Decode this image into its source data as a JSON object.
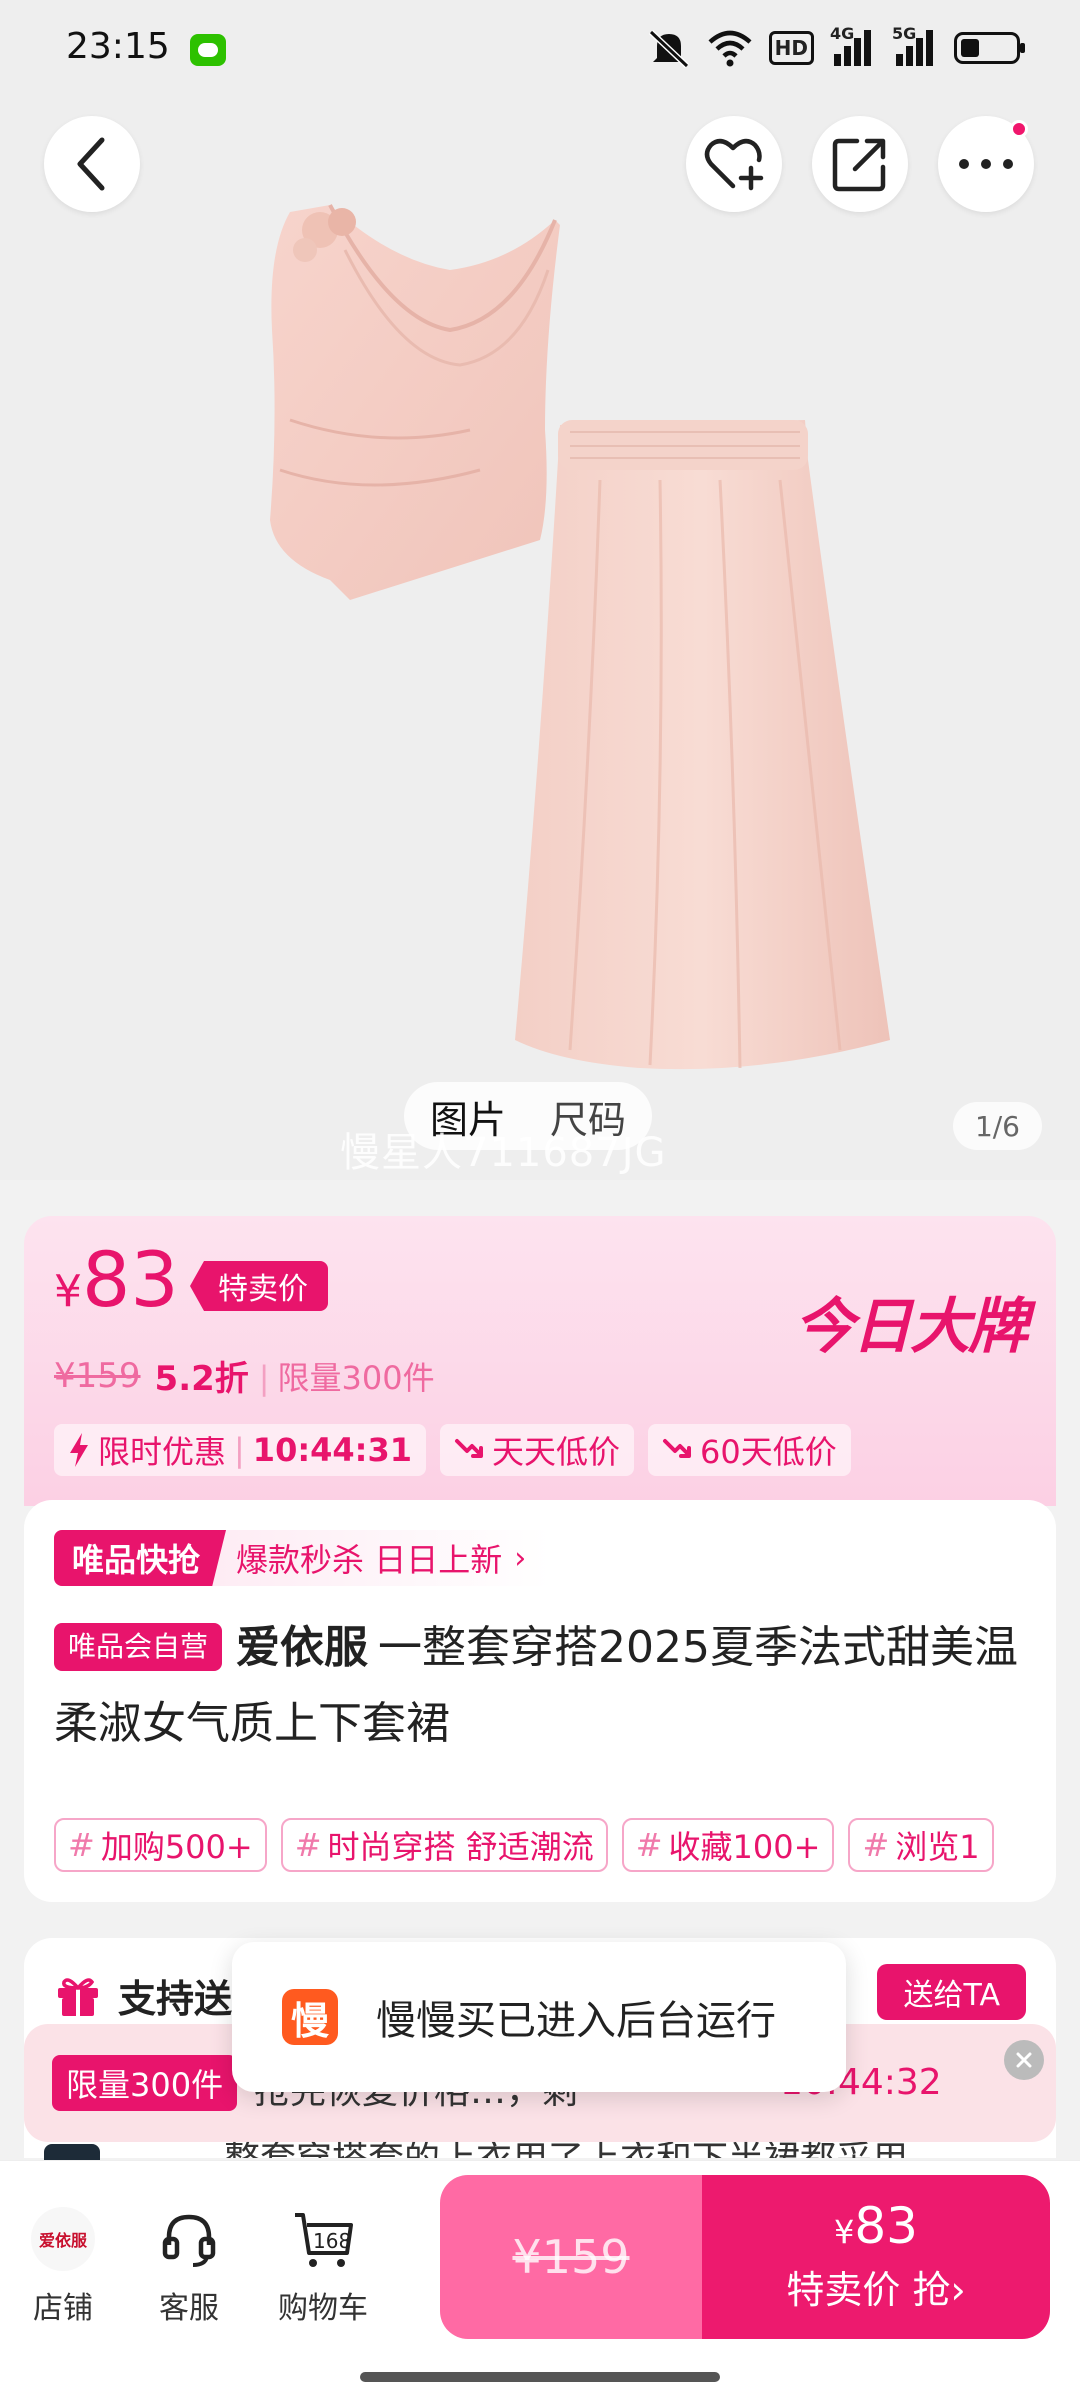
{
  "status_bar": {
    "time": "23:15",
    "hd_label": "HD",
    "signal_labels": [
      "4G",
      "5G"
    ]
  },
  "hero": {
    "media_tabs": [
      "图片",
      "尺码"
    ],
    "pager": "1/6",
    "watermark": "慢星人711687JG"
  },
  "price": {
    "currency": "¥",
    "current": "83",
    "sale_tag": "特卖价",
    "brand_logo": "今日大牌",
    "original": "¥159",
    "discount": "5.2折",
    "limit": "限量300件",
    "promos": [
      {
        "label": "限时优惠",
        "countdown": "10:44:31"
      },
      {
        "label": "天天低价"
      },
      {
        "label": "60天低价"
      }
    ]
  },
  "product": {
    "flash_tag": "唯品快抢",
    "flash_text": "爆款秒杀 日日上新",
    "flash_arrow": "›",
    "self_tag": "唯品会自营",
    "brand": "爱依服",
    "title": "一整套穿搭2025夏季法式甜美温柔淑女气质上下套裙",
    "hashtags": [
      "加购500+",
      "时尚穿搭 舒适潮流",
      "收藏100+",
      "浏览1"
    ]
  },
  "gift": {
    "title": "支持送",
    "button": "送给TA",
    "desc": "整套穿搭套的上衣用了上衣和下半裙都采用"
  },
  "limit_banner": {
    "badge": "限量300件",
    "text": "抢完恢复价格…，剩",
    "countdown": "10:44:32"
  },
  "toast": {
    "icon_text": "慢",
    "text": "慢慢买已进入后台运行"
  },
  "bottom_bar": {
    "store": "店铺",
    "store_logo": "爱依服",
    "service": "客服",
    "cart": "购物车",
    "cart_count": "168",
    "buy_original": "¥159",
    "buy_currency": "¥",
    "buy_price": "83",
    "buy_label": "特卖价 抢›"
  },
  "colors": {
    "accent": "#e8146c",
    "accent_light": "#ff6aa4",
    "card_bg": "#fde3ef"
  }
}
